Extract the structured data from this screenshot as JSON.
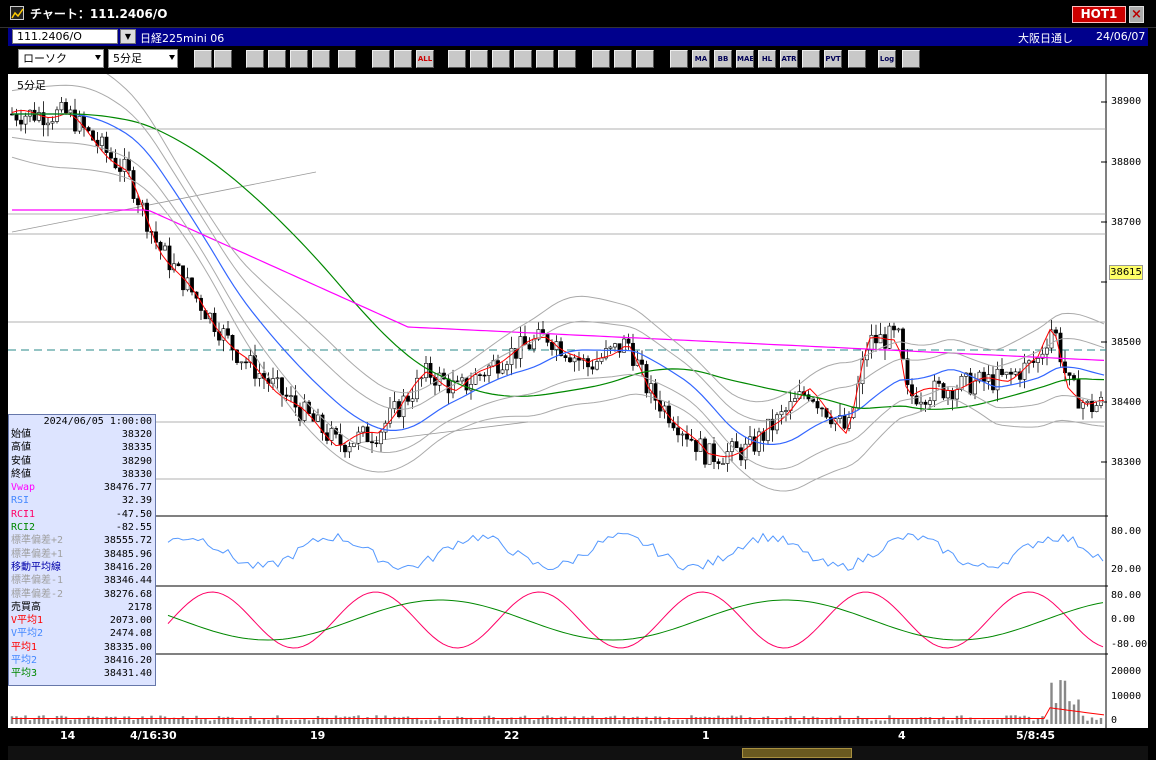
{
  "window": {
    "title": "チャート：111.2406/O",
    "hot_label": "HOT1",
    "close_label": "×"
  },
  "header": {
    "symbol_code": "111.2406/O",
    "symbol_name": "日経225mini 06",
    "market": "大阪日通し",
    "date": "24/06/07"
  },
  "toolbar": {
    "chart_type": "ローソク",
    "timeframe": "5分足",
    "buttons": [
      {
        "name": "zoom-button",
        "label": ""
      },
      {
        "name": "layout-button",
        "label": ""
      },
      {
        "name": "tool-1-button",
        "label": ""
      },
      {
        "name": "tool-2-button",
        "label": ""
      },
      {
        "name": "tool-3-button",
        "label": ""
      },
      {
        "name": "tool-4-button",
        "label": ""
      },
      {
        "name": "tool-5-button",
        "label": ""
      },
      {
        "name": "tool-6-button",
        "label": ""
      },
      {
        "name": "tool-7-button",
        "label": ""
      },
      {
        "name": "all-button",
        "label": "ALL"
      },
      {
        "name": "draw-1-button",
        "label": ""
      },
      {
        "name": "draw-2-button",
        "label": ""
      },
      {
        "name": "draw-3-button",
        "label": ""
      },
      {
        "name": "draw-4-button",
        "label": ""
      },
      {
        "name": "draw-5-button",
        "label": ""
      },
      {
        "name": "delete-button",
        "label": ""
      },
      {
        "name": "setting-1-button",
        "label": ""
      },
      {
        "name": "setting-2-button",
        "label": ""
      },
      {
        "name": "color-button",
        "label": ""
      },
      {
        "name": "indicator-1-button",
        "label": ""
      },
      {
        "name": "ma-button",
        "label": "MA"
      },
      {
        "name": "bb-button",
        "label": "BB"
      },
      {
        "name": "mae-button",
        "label": "MAE"
      },
      {
        "name": "hl-button",
        "label": "HL"
      },
      {
        "name": "atr-button",
        "label": "ATR"
      },
      {
        "name": "indicator-2-button",
        "label": ""
      },
      {
        "name": "pvt-button",
        "label": "PVT"
      },
      {
        "name": "frame-button",
        "label": ""
      },
      {
        "name": "log-button",
        "label": "Log"
      },
      {
        "name": "export-button",
        "label": ""
      }
    ]
  },
  "chart": {
    "timeframe_label": "5分足",
    "price_axis": [
      "38900",
      "38800",
      "38700",
      "38600",
      "38500",
      "38400",
      "38300"
    ],
    "current_price": "38615",
    "rsi_axis": [
      "80.00",
      "20.00"
    ],
    "rci_axis": [
      "80.00",
      "0.00",
      "-80.00"
    ],
    "volume_axis": [
      "20000",
      "10000",
      "0"
    ],
    "x_labels": [
      "14",
      "4/16:30",
      "19",
      "22",
      "1",
      "4",
      "5/8:45"
    ]
  },
  "info": {
    "date": "2024/06/05 1:00:00",
    "rows": [
      {
        "label": "始値",
        "value": "38320",
        "color": "#000000"
      },
      {
        "label": "高値",
        "value": "38335",
        "color": "#000000"
      },
      {
        "label": "安値",
        "value": "38290",
        "color": "#000000"
      },
      {
        "label": "終値",
        "value": "38330",
        "color": "#000000"
      },
      {
        "label": "Vwap",
        "value": "38476.77",
        "color": "#ff00ff"
      },
      {
        "label": "RSI",
        "value": "32.39",
        "color": "#4488ff"
      },
      {
        "label": "RCI1",
        "value": "-47.50",
        "color": "#ff0066"
      },
      {
        "label": "RCI2",
        "value": "-82.55",
        "color": "#008800"
      },
      {
        "label": "標準偏差+2",
        "value": "38555.72",
        "color": "#a0a0a0"
      },
      {
        "label": "標準偏差+1",
        "value": "38485.96",
        "color": "#a0a0a0"
      },
      {
        "label": "移動平均線",
        "value": "38416.20",
        "color": "#0000aa"
      },
      {
        "label": "標準偏差-1",
        "value": "38346.44",
        "color": "#a0a0a0"
      },
      {
        "label": "標準偏差-2",
        "value": "38276.68",
        "color": "#a0a0a0"
      },
      {
        "label": "売買高",
        "value": "2178",
        "color": "#000000"
      },
      {
        "label": "V平均1",
        "value": "2073.00",
        "color": "#ff0000"
      },
      {
        "label": "V平均2",
        "value": "2474.08",
        "color": "#4488ff"
      },
      {
        "label": "平均1",
        "value": "38335.00",
        "color": "#ff0000"
      },
      {
        "label": "平均2",
        "value": "38416.20",
        "color": "#4488ff"
      },
      {
        "label": "平均3",
        "value": "38431.40",
        "color": "#008800"
      }
    ]
  },
  "colors": {
    "up": "#ffffff",
    "down": "#000000",
    "ma_red": "#ff0000",
    "ma_blue": "#3366ff",
    "ma_green": "#008800",
    "vwap": "#ff00ff",
    "bollinger": "#aaaaaa",
    "rsi": "#5599ff",
    "rci_fast": "#ff0066",
    "rci_slow": "#008800",
    "volume": "#888888"
  }
}
